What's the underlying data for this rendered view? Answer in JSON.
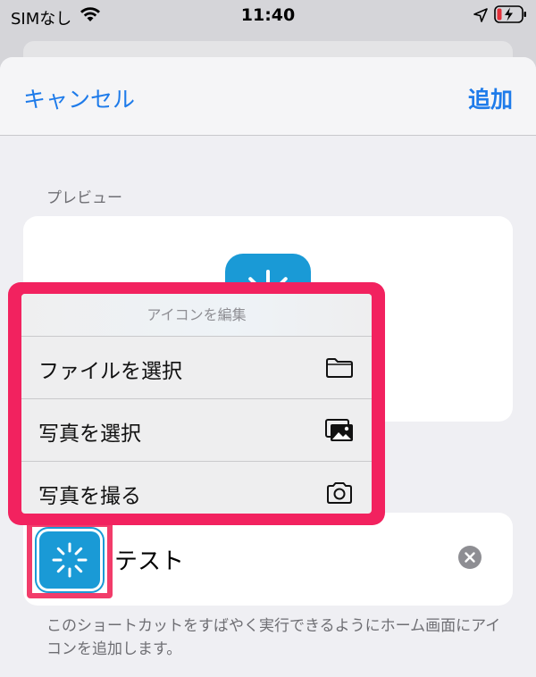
{
  "status_bar": {
    "carrier": "SIMなし",
    "time": "11:40",
    "icons": [
      "wifi-icon",
      "location-arrow-icon",
      "battery-charging-icon"
    ]
  },
  "nav": {
    "cancel_label": "キャンセル",
    "add_label": "追加"
  },
  "preview": {
    "section_label": "プレビュー"
  },
  "context_menu": {
    "title": "アイコンを編集",
    "items": [
      {
        "label": "ファイルを選択",
        "icon": "folder-icon"
      },
      {
        "label": "写真を選択",
        "icon": "photos-icon"
      },
      {
        "label": "写真を撮る",
        "icon": "camera-icon"
      }
    ]
  },
  "shortcut": {
    "name": "テスト",
    "icon": "loading-spinner-icon",
    "description": "このショートカットをすばやく実行できるようにホーム画面にアイコンを追加します。"
  },
  "colors": {
    "accent": "#1e7bea",
    "icon_background": "#1a9ad6",
    "highlight": "#f2225f",
    "sheet_background": "#efeff3"
  }
}
